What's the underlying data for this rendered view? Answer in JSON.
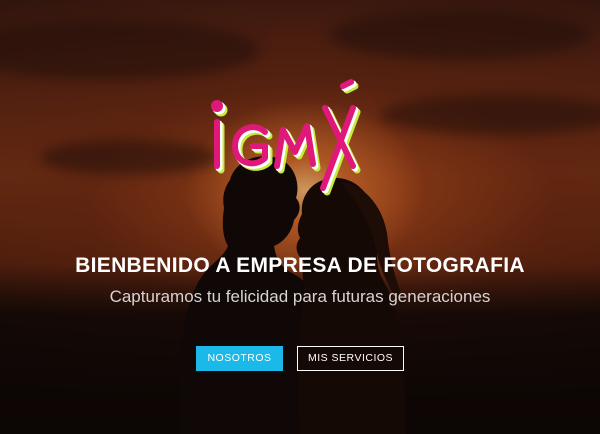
{
  "hero": {
    "logo_text": "iGMX",
    "title": "BIENBENIDO A EMPRESA DE FOTOGRAFIA",
    "subtitle": "Capturamos tu felicidad para futuras generaciones"
  },
  "buttons": {
    "primary_label": "NOSOTROS",
    "secondary_label": "MIS SERVICIOS"
  },
  "colors": {
    "accent": "#1ab9e8",
    "logo_magenta": "#e0187a",
    "logo_lime": "#c8ea3a"
  }
}
